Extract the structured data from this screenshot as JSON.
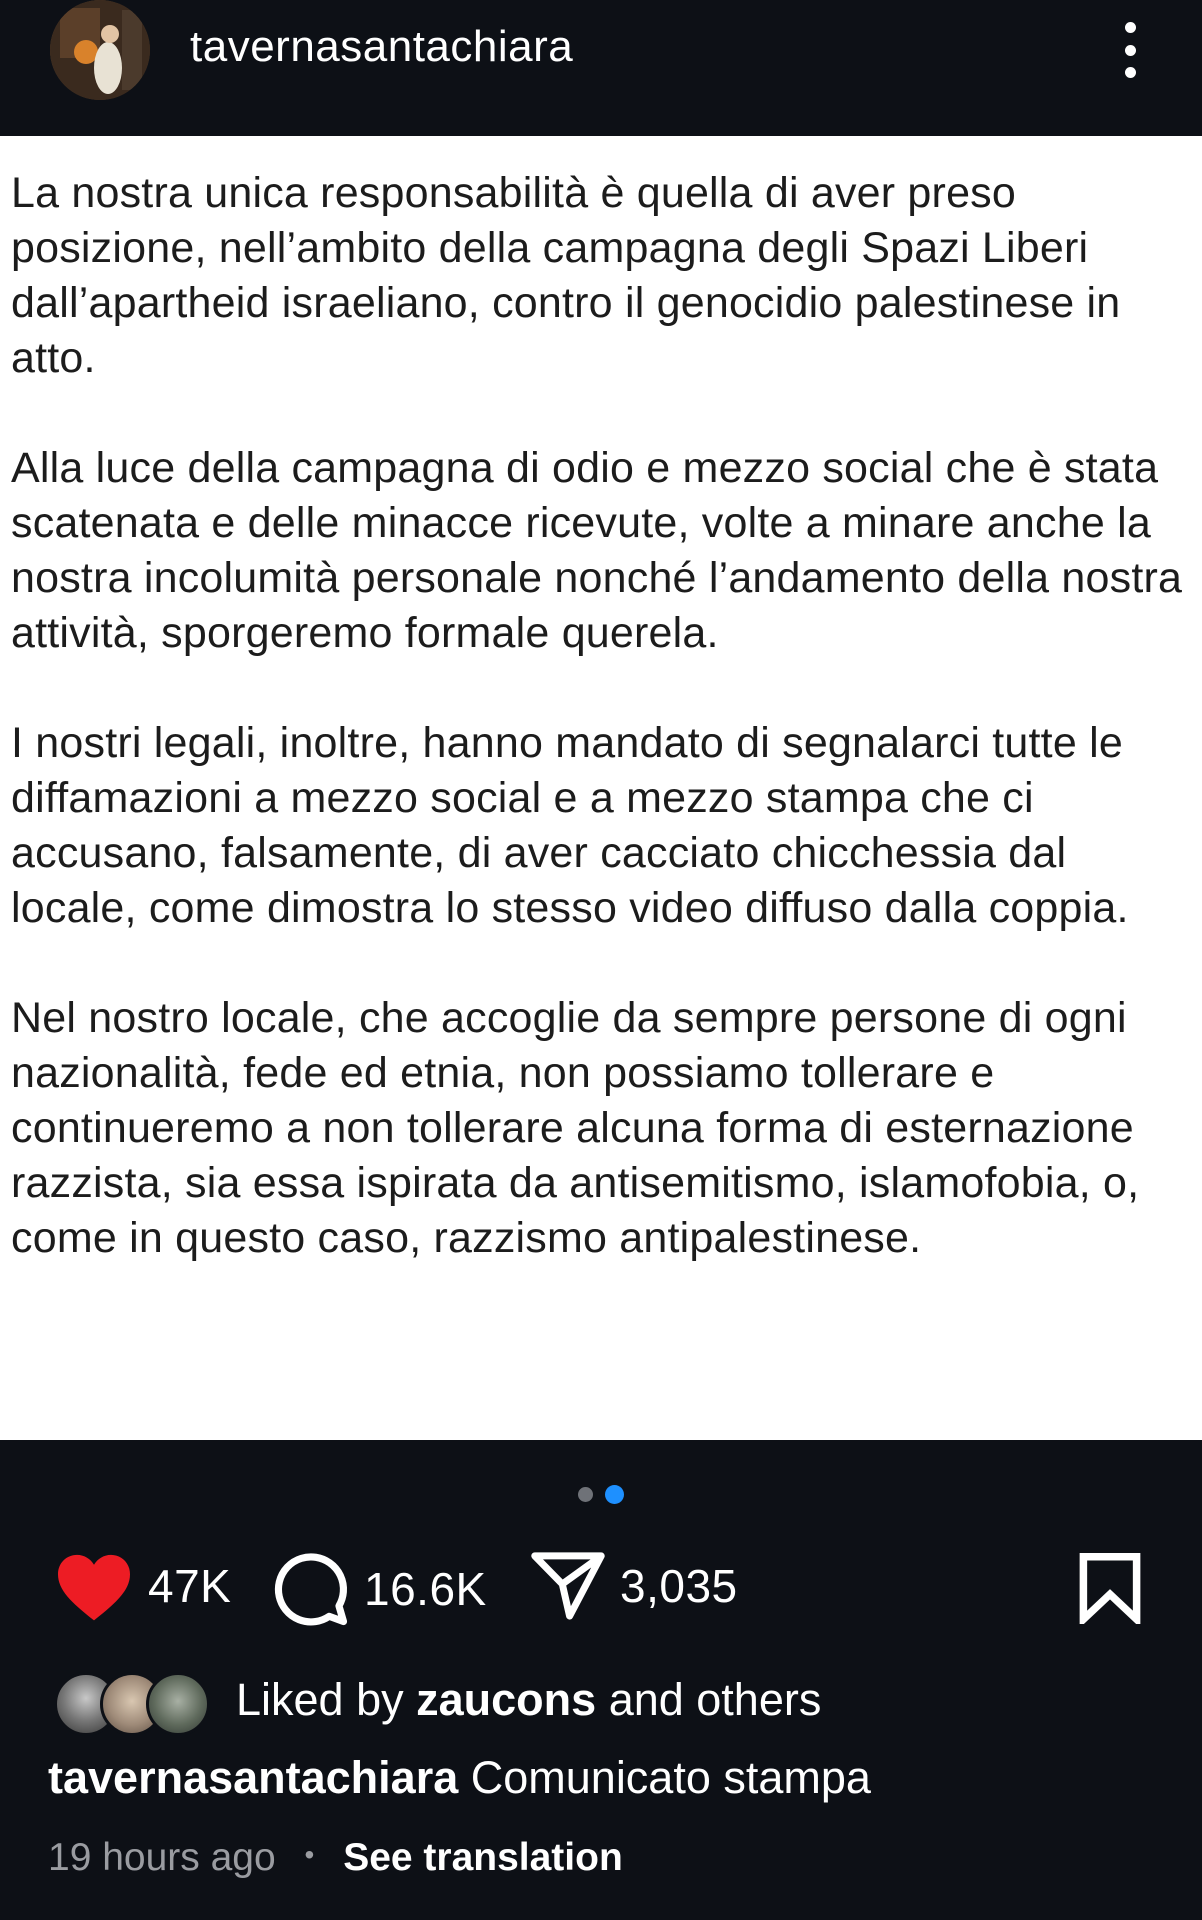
{
  "header": {
    "username": "tavernasantachiara",
    "avatar_icon": "profile-avatar",
    "more_icon": "more-vertical-icon"
  },
  "post": {
    "paragraphs": [
      "La nostra unica responsabilità è quella di aver preso posizione, nell’ambito della campagna degli Spazi Liberi dall’apartheid israeliano, contro il genocidio palestinese in atto.",
      "Alla luce della campagna di odio e mezzo social che è stata scatenata e delle minacce ricevute, volte a minare anche la nostra incolumità personale nonché l’andamento della nostra attività, sporgeremo formale querela.",
      "I nostri legali, inoltre, hanno mandato di segnalarci tutte le diffamazioni a mezzo social e a mezzo stampa che ci accusano, falsamente, di aver cacciato chicchessia dal locale, come dimostra lo stesso video diffuso dalla coppia.",
      "Nel nostro locale, che accoglie da sempre persone di ogni nazionalità, fede ed etnia, non possiamo tollerare e continueremo a non tollerare alcuna forma di esternazione razzista, sia essa ispirata da antisemitismo, islamofobia, o, come in questo caso, razzismo antipalestinese."
    ],
    "carousel": {
      "total": 2,
      "active": 2
    }
  },
  "actions": {
    "likes": "47K",
    "comments": "16.6K",
    "shares": "3,035",
    "like_icon": "heart-filled-icon",
    "comment_icon": "comment-icon",
    "share_icon": "send-icon",
    "save_icon": "bookmark-icon",
    "like_color": "#ed1c24"
  },
  "liked_by": {
    "prefix": "Liked by",
    "user": "zaucons",
    "suffix": "and others"
  },
  "caption": {
    "username": "tavernasantachiara",
    "text": "Comunicato stampa"
  },
  "meta": {
    "time": "19 hours ago",
    "separator": "•",
    "translate": "See translation"
  }
}
